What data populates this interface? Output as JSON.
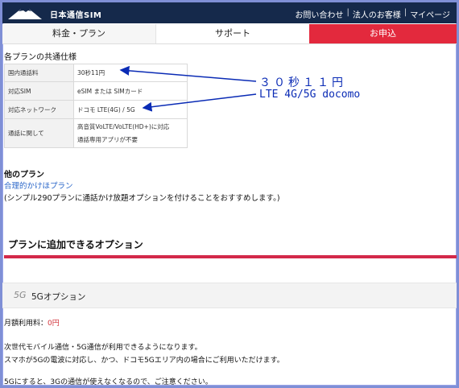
{
  "header": {
    "logo_text": "日本通信SIM",
    "links": [
      "お問い合わせ",
      "法人のお客様",
      "マイページ"
    ],
    "separator": "|"
  },
  "tabs": [
    {
      "label": "料金・プラン"
    },
    {
      "label": "サポート"
    },
    {
      "label": "お申込"
    }
  ],
  "spec": {
    "title": "各プランの共通仕様",
    "rows": [
      {
        "key": "国内通話料",
        "value": "30秒11円"
      },
      {
        "key": "対応SIM",
        "value": "eSIM または SIMカード"
      },
      {
        "key": "対応ネットワーク",
        "value": "ドコモ LTE(4G) / 5G"
      },
      {
        "key": "通話に関して",
        "value": "高音質VoLTE/VoLTE(HD+)に対応",
        "value2": "通話専用アプリが不要"
      }
    ]
  },
  "annotations": {
    "price": "３０秒１１円",
    "network": "LTE 4G/5G docomo",
    "color": "#0a2bb5"
  },
  "other_plans": {
    "title": "他のプラン",
    "link": "合理的かけほプラン",
    "note": "(シンプル290プランに通話かけ放題オプションを付けることをおすすめします。)"
  },
  "options": {
    "heading": "プランに追加できるオプション",
    "accent_color": "#d3294a",
    "item": {
      "icon_text": "5G",
      "label": "5Gオプション",
      "fee_label": "月額利用料：",
      "fee_value": "0円",
      "desc1": "次世代モバイル通信・5G通信が利用できるようになります。",
      "desc2": "スマホが5Gの電波に対応し、かつ、ドコモ5Gエリア内の場合にご利用いただけます。",
      "warning": "5Gにすると、3Gの通信が使えなくなるので、ご注意ください。"
    }
  }
}
